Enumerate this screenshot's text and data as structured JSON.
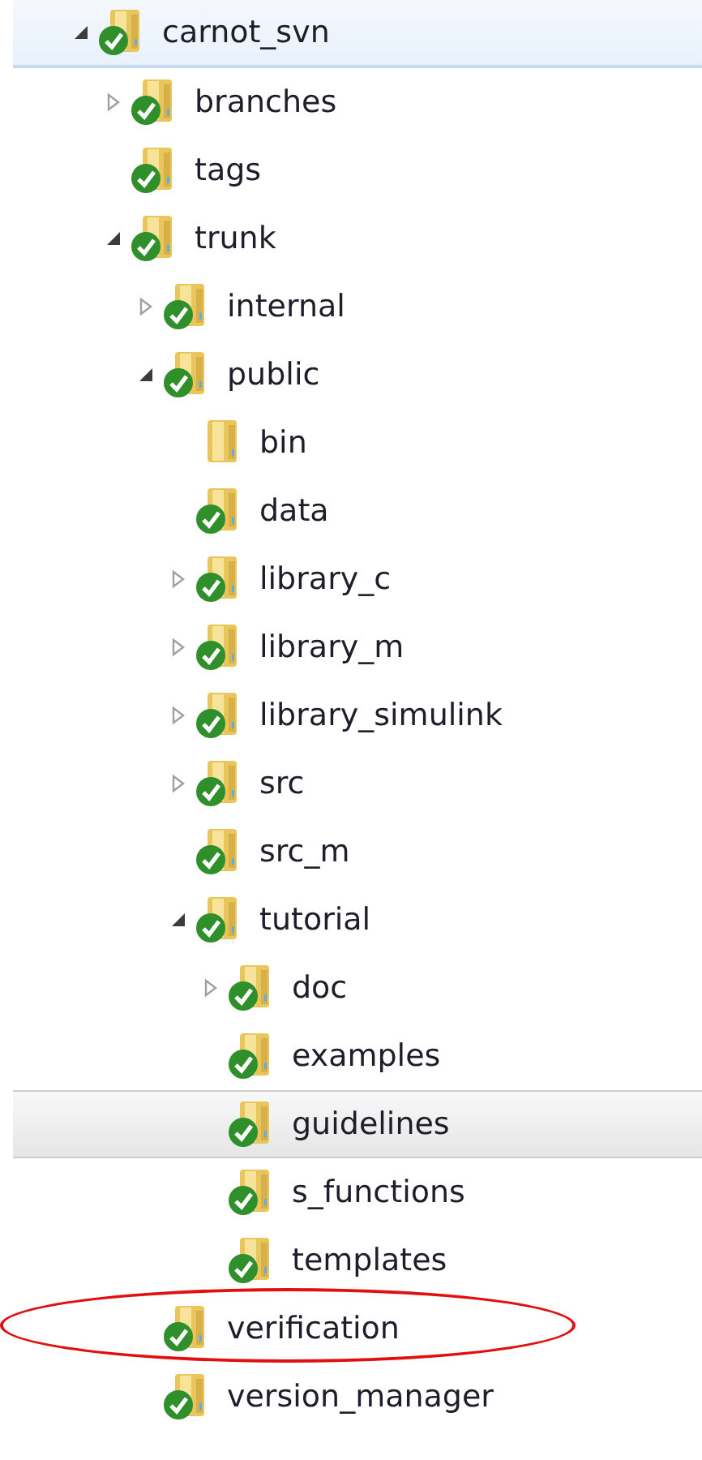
{
  "tree": [
    {
      "label": "carnot_svn",
      "expanded": true,
      "versioned": true,
      "selected": false,
      "hovered": true,
      "circled": false,
      "children": [
        {
          "label": "branches",
          "expanded": false,
          "versioned": true,
          "selected": false,
          "hovered": false,
          "circled": false
        },
        {
          "label": "tags",
          "versioned": true,
          "selected": false,
          "hovered": false,
          "circled": false
        },
        {
          "label": "trunk",
          "expanded": true,
          "versioned": true,
          "selected": false,
          "hovered": false,
          "circled": false,
          "children": [
            {
              "label": "internal",
              "expanded": false,
              "versioned": true,
              "selected": false,
              "hovered": false,
              "circled": false
            },
            {
              "label": "public",
              "expanded": true,
              "versioned": true,
              "selected": false,
              "hovered": false,
              "circled": false,
              "children": [
                {
                  "label": "bin",
                  "versioned": false,
                  "selected": false,
                  "hovered": false,
                  "circled": false
                },
                {
                  "label": "data",
                  "versioned": true,
                  "selected": false,
                  "hovered": false,
                  "circled": false
                },
                {
                  "label": "library_c",
                  "expanded": false,
                  "versioned": true,
                  "selected": false,
                  "hovered": false,
                  "circled": false
                },
                {
                  "label": "library_m",
                  "expanded": false,
                  "versioned": true,
                  "selected": false,
                  "hovered": false,
                  "circled": false
                },
                {
                  "label": "library_simulink",
                  "expanded": false,
                  "versioned": true,
                  "selected": false,
                  "hovered": false,
                  "circled": false
                },
                {
                  "label": "src",
                  "expanded": false,
                  "versioned": true,
                  "selected": false,
                  "hovered": false,
                  "circled": false
                },
                {
                  "label": "src_m",
                  "versioned": true,
                  "selected": false,
                  "hovered": false,
                  "circled": false
                },
                {
                  "label": "tutorial",
                  "expanded": true,
                  "versioned": true,
                  "selected": false,
                  "hovered": false,
                  "circled": false,
                  "children": [
                    {
                      "label": "doc",
                      "expanded": false,
                      "versioned": true,
                      "selected": false,
                      "hovered": false,
                      "circled": false
                    },
                    {
                      "label": "examples",
                      "versioned": true,
                      "selected": false,
                      "hovered": false,
                      "circled": false
                    },
                    {
                      "label": "guidelines",
                      "versioned": true,
                      "selected": true,
                      "hovered": false,
                      "circled": false
                    },
                    {
                      "label": "s_functions",
                      "versioned": true,
                      "selected": false,
                      "hovered": false,
                      "circled": false
                    },
                    {
                      "label": "templates",
                      "versioned": true,
                      "selected": false,
                      "hovered": false,
                      "circled": false
                    }
                  ]
                }
              ]
            },
            {
              "label": "verification",
              "versioned": true,
              "selected": false,
              "hovered": false,
              "circled": true
            },
            {
              "label": "version_manager",
              "versioned": true,
              "selected": false,
              "hovered": false,
              "circled": false
            }
          ]
        }
      ]
    }
  ]
}
